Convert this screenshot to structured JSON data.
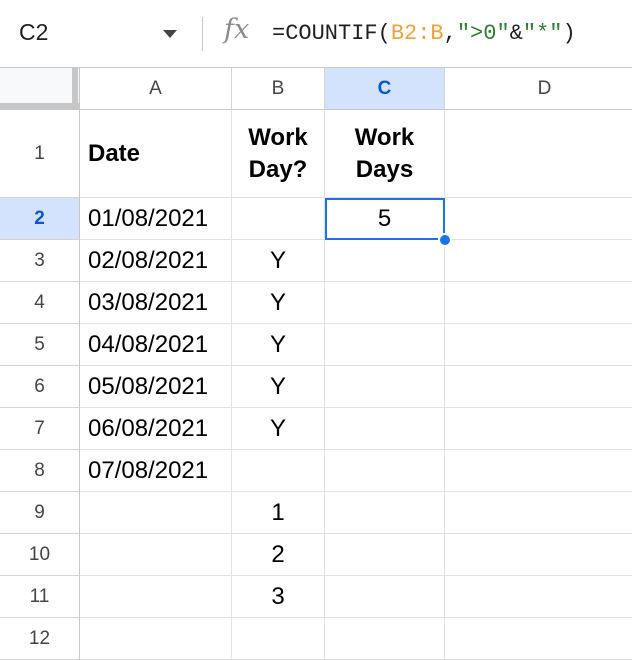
{
  "formula_bar": {
    "name_box": "C2",
    "fx_label": "fx",
    "formula": {
      "prefix": "=COUNTIF(",
      "range": "B2:B",
      "comma": ",",
      "str1": "\">0\"",
      "amp": "&",
      "str2": "\"*\"",
      "suffix": ")"
    }
  },
  "columns": [
    "A",
    "B",
    "C",
    "D"
  ],
  "selected_column": "C",
  "rows": [
    "1",
    "2",
    "3",
    "4",
    "5",
    "6",
    "7",
    "8",
    "9",
    "10",
    "11",
    "12"
  ],
  "selected_row": "2",
  "cells": {
    "A1": "Date",
    "B1": "Work\nDay?",
    "C1": "Work\nDays",
    "A2": "01/08/2021",
    "C2": "5",
    "A3": "02/08/2021",
    "B3": "Y",
    "A4": "03/08/2021",
    "B4": "Y",
    "A5": "04/08/2021",
    "B5": "Y",
    "A6": "05/08/2021",
    "B6": "Y",
    "A7": "06/08/2021",
    "B7": "Y",
    "A8": "07/08/2021",
    "B9": "1",
    "B10": "2",
    "B11": "3"
  },
  "colors": {
    "selection": "#1a73e8",
    "header_selected_bg": "#d3e3fd",
    "formula_range": "#e8a33d",
    "formula_string": "#2e7d32"
  }
}
